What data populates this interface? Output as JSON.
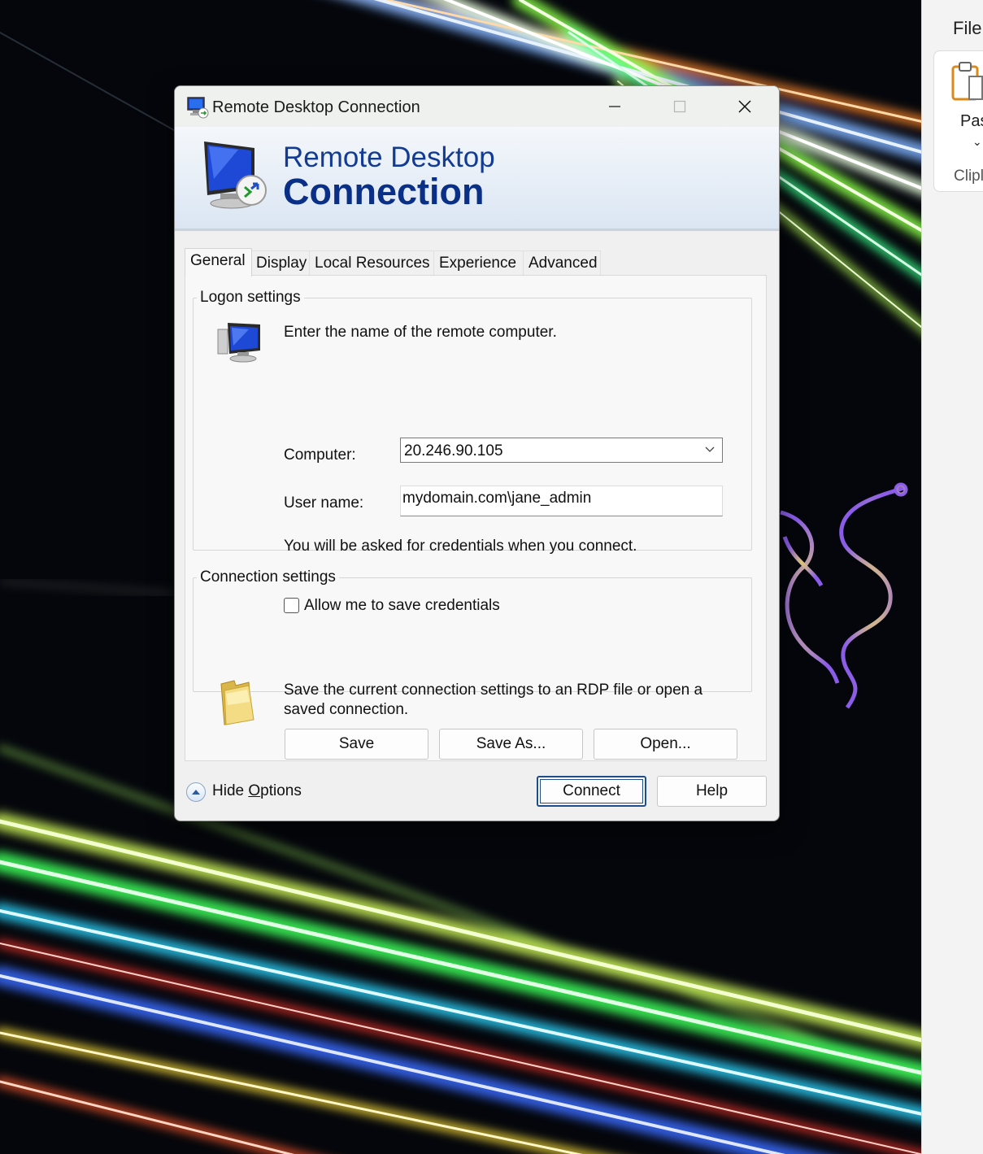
{
  "right_app": {
    "file_tab": "File",
    "paste_label": "Pas",
    "clipboard_label": "Clipl"
  },
  "dialog": {
    "title": "Remote Desktop Connection",
    "banner_line1": "Remote Desktop",
    "banner_line2": "Connection",
    "tabs": [
      {
        "label": "General",
        "active": true
      },
      {
        "label": "Display"
      },
      {
        "label": "Local Resources"
      },
      {
        "label": "Experience"
      },
      {
        "label": "Advanced"
      }
    ],
    "logon": {
      "legend": "Logon settings",
      "instruction": "Enter the name of the remote computer.",
      "computer_label": "Computer:",
      "computer_value": "20.246.90.105",
      "username_label": "User name:",
      "username_value": "mydomain.com\\jane_admin",
      "credentials_note": "You will be asked for credentials when you connect.",
      "save_credentials_label": "Allow me to save credentials",
      "save_credentials_checked": false
    },
    "connection": {
      "legend": "Connection settings",
      "description_line1": "Save the current connection settings to an RDP file or open a",
      "description_line2": "saved connection.",
      "save": "Save",
      "save_as": "Save As...",
      "open": "Open..."
    },
    "footer": {
      "hide_options_prefix": "Hide ",
      "hide_options_mnemonic": "O",
      "hide_options_suffix": "ptions",
      "connect": "Connect",
      "help": "Help"
    }
  }
}
